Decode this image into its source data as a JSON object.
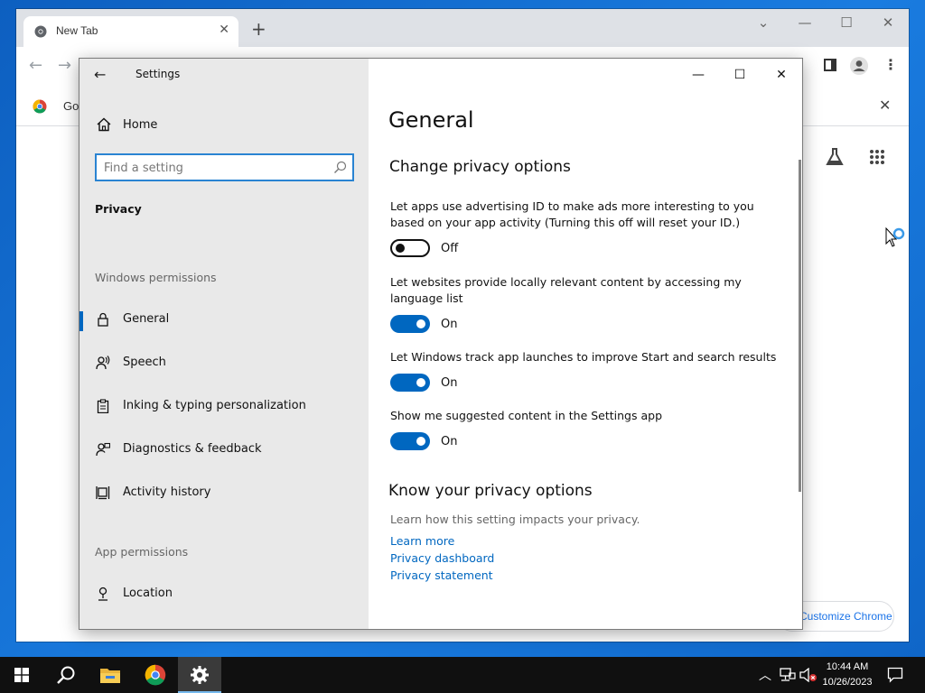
{
  "chrome": {
    "tab_title": "New Tab",
    "bookmark_text": "Goo",
    "customize_label": "Customize Chrome"
  },
  "settings": {
    "app_title": "Settings",
    "home_label": "Home",
    "search_placeholder": "Find a setting",
    "section": "Privacy",
    "windows_permissions_label": "Windows permissions",
    "nav_items": [
      {
        "label": "General",
        "icon": "lock-icon",
        "selected": true
      },
      {
        "label": "Speech",
        "icon": "speech-icon"
      },
      {
        "label": "Inking & typing personalization",
        "icon": "clipboard-icon"
      },
      {
        "label": "Diagnostics & feedback",
        "icon": "feedback-icon"
      },
      {
        "label": "Activity history",
        "icon": "timeline-icon"
      }
    ],
    "app_permissions_label": "App permissions",
    "app_nav_items": [
      {
        "label": "Location",
        "icon": "location-icon"
      }
    ]
  },
  "content": {
    "page_title": "General",
    "subtitle": "Change privacy options",
    "options": [
      {
        "description": "Let apps use advertising ID to make ads more interesting to you based on your app activity (Turning this off will reset your ID.)",
        "state": "Off",
        "on": false
      },
      {
        "description": "Let websites provide locally relevant content by accessing my language list",
        "state": "On",
        "on": true
      },
      {
        "description": "Let Windows track app launches to improve Start and search results",
        "state": "On",
        "on": true
      },
      {
        "description": "Show me suggested content in the Settings app",
        "state": "On",
        "on": true
      }
    ],
    "know_title": "Know your privacy options",
    "know_desc": "Learn how this setting impacts your privacy.",
    "links": [
      "Learn more",
      "Privacy dashboard",
      "Privacy statement"
    ]
  },
  "taskbar": {
    "time": "10:44 AM",
    "date": "10/26/2023"
  },
  "colors": {
    "accent": "#0067c0",
    "desktop": "#1677d6",
    "taskbar": "#101010"
  }
}
